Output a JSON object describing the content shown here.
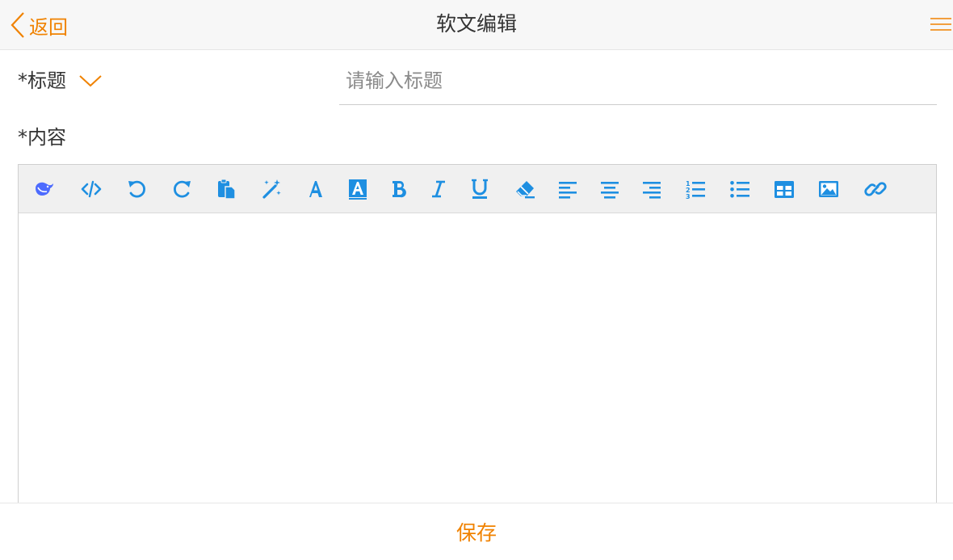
{
  "header": {
    "back_label": "返回",
    "title": "软文编辑"
  },
  "form": {
    "title_label": "*标题",
    "title_placeholder": "请输入标题",
    "title_value": "",
    "content_label": "*内容"
  },
  "toolbar": {
    "items": [
      "deepseek-icon",
      "code-view-icon",
      "undo-icon",
      "redo-icon",
      "paste-icon",
      "magic-wand-icon",
      "font-color-icon",
      "background-color-icon",
      "bold-icon",
      "italic-icon",
      "underline-icon",
      "eraser-icon",
      "align-left-icon",
      "align-center-icon",
      "align-right-icon",
      "ordered-list-icon",
      "unordered-list-icon",
      "table-icon",
      "image-icon",
      "link-icon"
    ]
  },
  "footer": {
    "save_label": "保存"
  },
  "colors": {
    "accent": "#f08200",
    "toolbar_icon": "#1e8fe1",
    "deepseek": "#4d6bfe"
  }
}
